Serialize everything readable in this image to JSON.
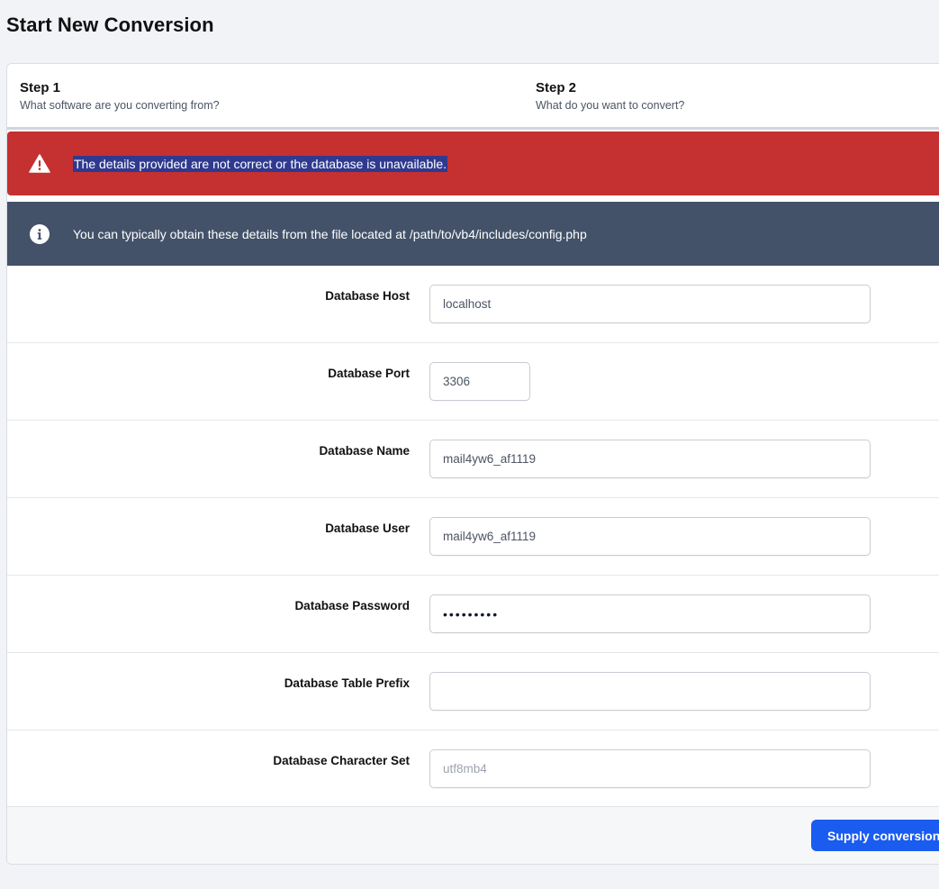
{
  "page": {
    "title": "Start New Conversion"
  },
  "steps": [
    {
      "title": "Step 1",
      "description": "What software are you converting from?"
    },
    {
      "title": "Step 2",
      "description": "What do you want to convert?"
    }
  ],
  "alerts": {
    "error": {
      "icon": "warning-triangle-icon",
      "text": "The details provided are not correct or the database is unavailable.",
      "color": "#c53030"
    },
    "info": {
      "icon": "info-circle-icon",
      "text": "You can typically obtain these details from the file located at /path/to/vb4/includes/config.php",
      "color": "#435269"
    }
  },
  "form": {
    "host": {
      "label": "Database Host",
      "value": "localhost",
      "placeholder": ""
    },
    "port": {
      "label": "Database Port",
      "value": "3306",
      "placeholder": ""
    },
    "name": {
      "label": "Database Name",
      "value": "mail4yw6_af1119",
      "placeholder": ""
    },
    "user": {
      "label": "Database User",
      "value": "mail4yw6_af1119",
      "placeholder": ""
    },
    "password": {
      "label": "Database Password",
      "value": "•••••••••",
      "placeholder": ""
    },
    "prefix": {
      "label": "Database Table Prefix",
      "value": "",
      "placeholder": ""
    },
    "charset": {
      "label": "Database Character Set",
      "value": "",
      "placeholder": "utf8mb4"
    }
  },
  "footer": {
    "submit_label": "Supply conversion d",
    "accent": "#1a5cf0"
  }
}
